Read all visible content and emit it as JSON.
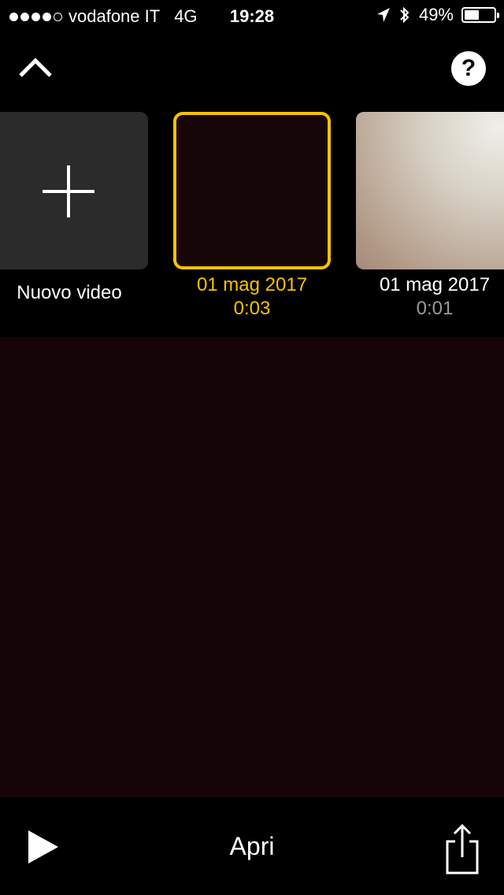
{
  "status_bar": {
    "signal_filled": 4,
    "signal_total": 5,
    "carrier": "vodafone IT",
    "network": "4G",
    "time": "19:28",
    "battery": "49%",
    "battery_level": 0.49,
    "icons": [
      "location-icon",
      "bluetooth-icon",
      "battery-icon"
    ]
  },
  "toolbar": {
    "collapse_icon": "chevron-up-icon",
    "help_label": "?"
  },
  "videos": [
    {
      "label": "Nuovo video",
      "icon": "plus-icon"
    },
    {
      "date": "01 mag 2017",
      "duration": "0:03",
      "selected": true
    },
    {
      "date": "01 mag 2017",
      "duration": "0:01",
      "selected": false
    }
  ],
  "bottom_bar": {
    "play_icon": "play-icon",
    "open_label": "Apri",
    "share_icon": "share-icon"
  },
  "colors": {
    "accent": "#f7c200",
    "background": "#000000",
    "preview": "#150508",
    "tile": "#2b2b2b"
  }
}
